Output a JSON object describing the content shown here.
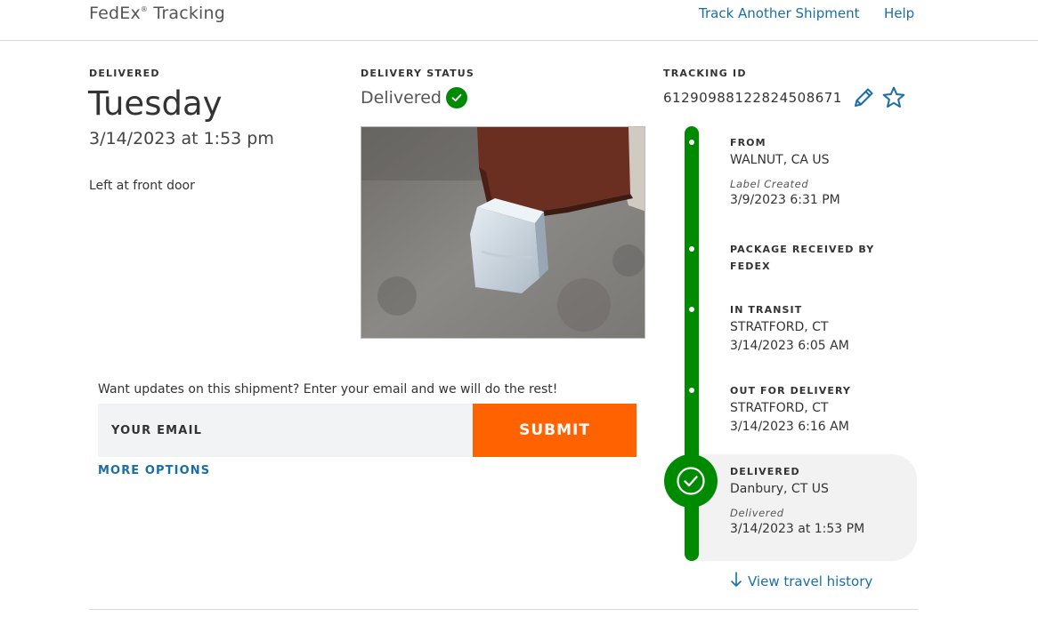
{
  "header": {
    "brand": "FedEx",
    "brand_mark": "®",
    "brand_suffix": "Tracking",
    "nav": [
      "Track Another Shipment",
      "Help"
    ]
  },
  "delivery": {
    "label": "DELIVERED",
    "day": "Tuesday",
    "date": "3/14/2023 at 1:53 pm",
    "note": "Left at front door"
  },
  "status": {
    "label": "DELIVERY STATUS",
    "value": "Delivered",
    "photo_icon": "package-photo"
  },
  "tracking": {
    "label": "TRACKING ID",
    "id": "612909881228245086​71",
    "edit_icon": "pencil-icon",
    "favorite_icon": "star-icon"
  },
  "updates": {
    "prompt": "Want updates on this shipment? Enter your email and we will do the rest!",
    "email_placeholder": "YOUR EMAIL",
    "submit_label": "SUBMIT",
    "more_options": "MORE OPTIONS"
  },
  "timeline": [
    {
      "title": "FROM",
      "line1": "WALNUT, CA US",
      "italic": "Label Created",
      "line2": "3/9/2023 6:31 PM"
    },
    {
      "title": "PACKAGE RECEIVED BY FEDEX"
    },
    {
      "title": "IN TRANSIT",
      "line1": "STRATFORD, CT",
      "line2": "3/14/2023 6:05 AM"
    },
    {
      "title": "OUT FOR DELIVERY",
      "line1": "STRATFORD, CT",
      "line2": "3/14/2023 6:16 AM"
    },
    {
      "title": "DELIVERED",
      "line1": "Danbury, CT US",
      "italic": "Delivered",
      "line2": "3/14/2023 at 1:53 PM"
    }
  ],
  "travel_history": "View travel history",
  "colors": {
    "accent_green": "#008a00",
    "submit_orange": "#ff6200",
    "link_blue": "#1a6ea8"
  }
}
